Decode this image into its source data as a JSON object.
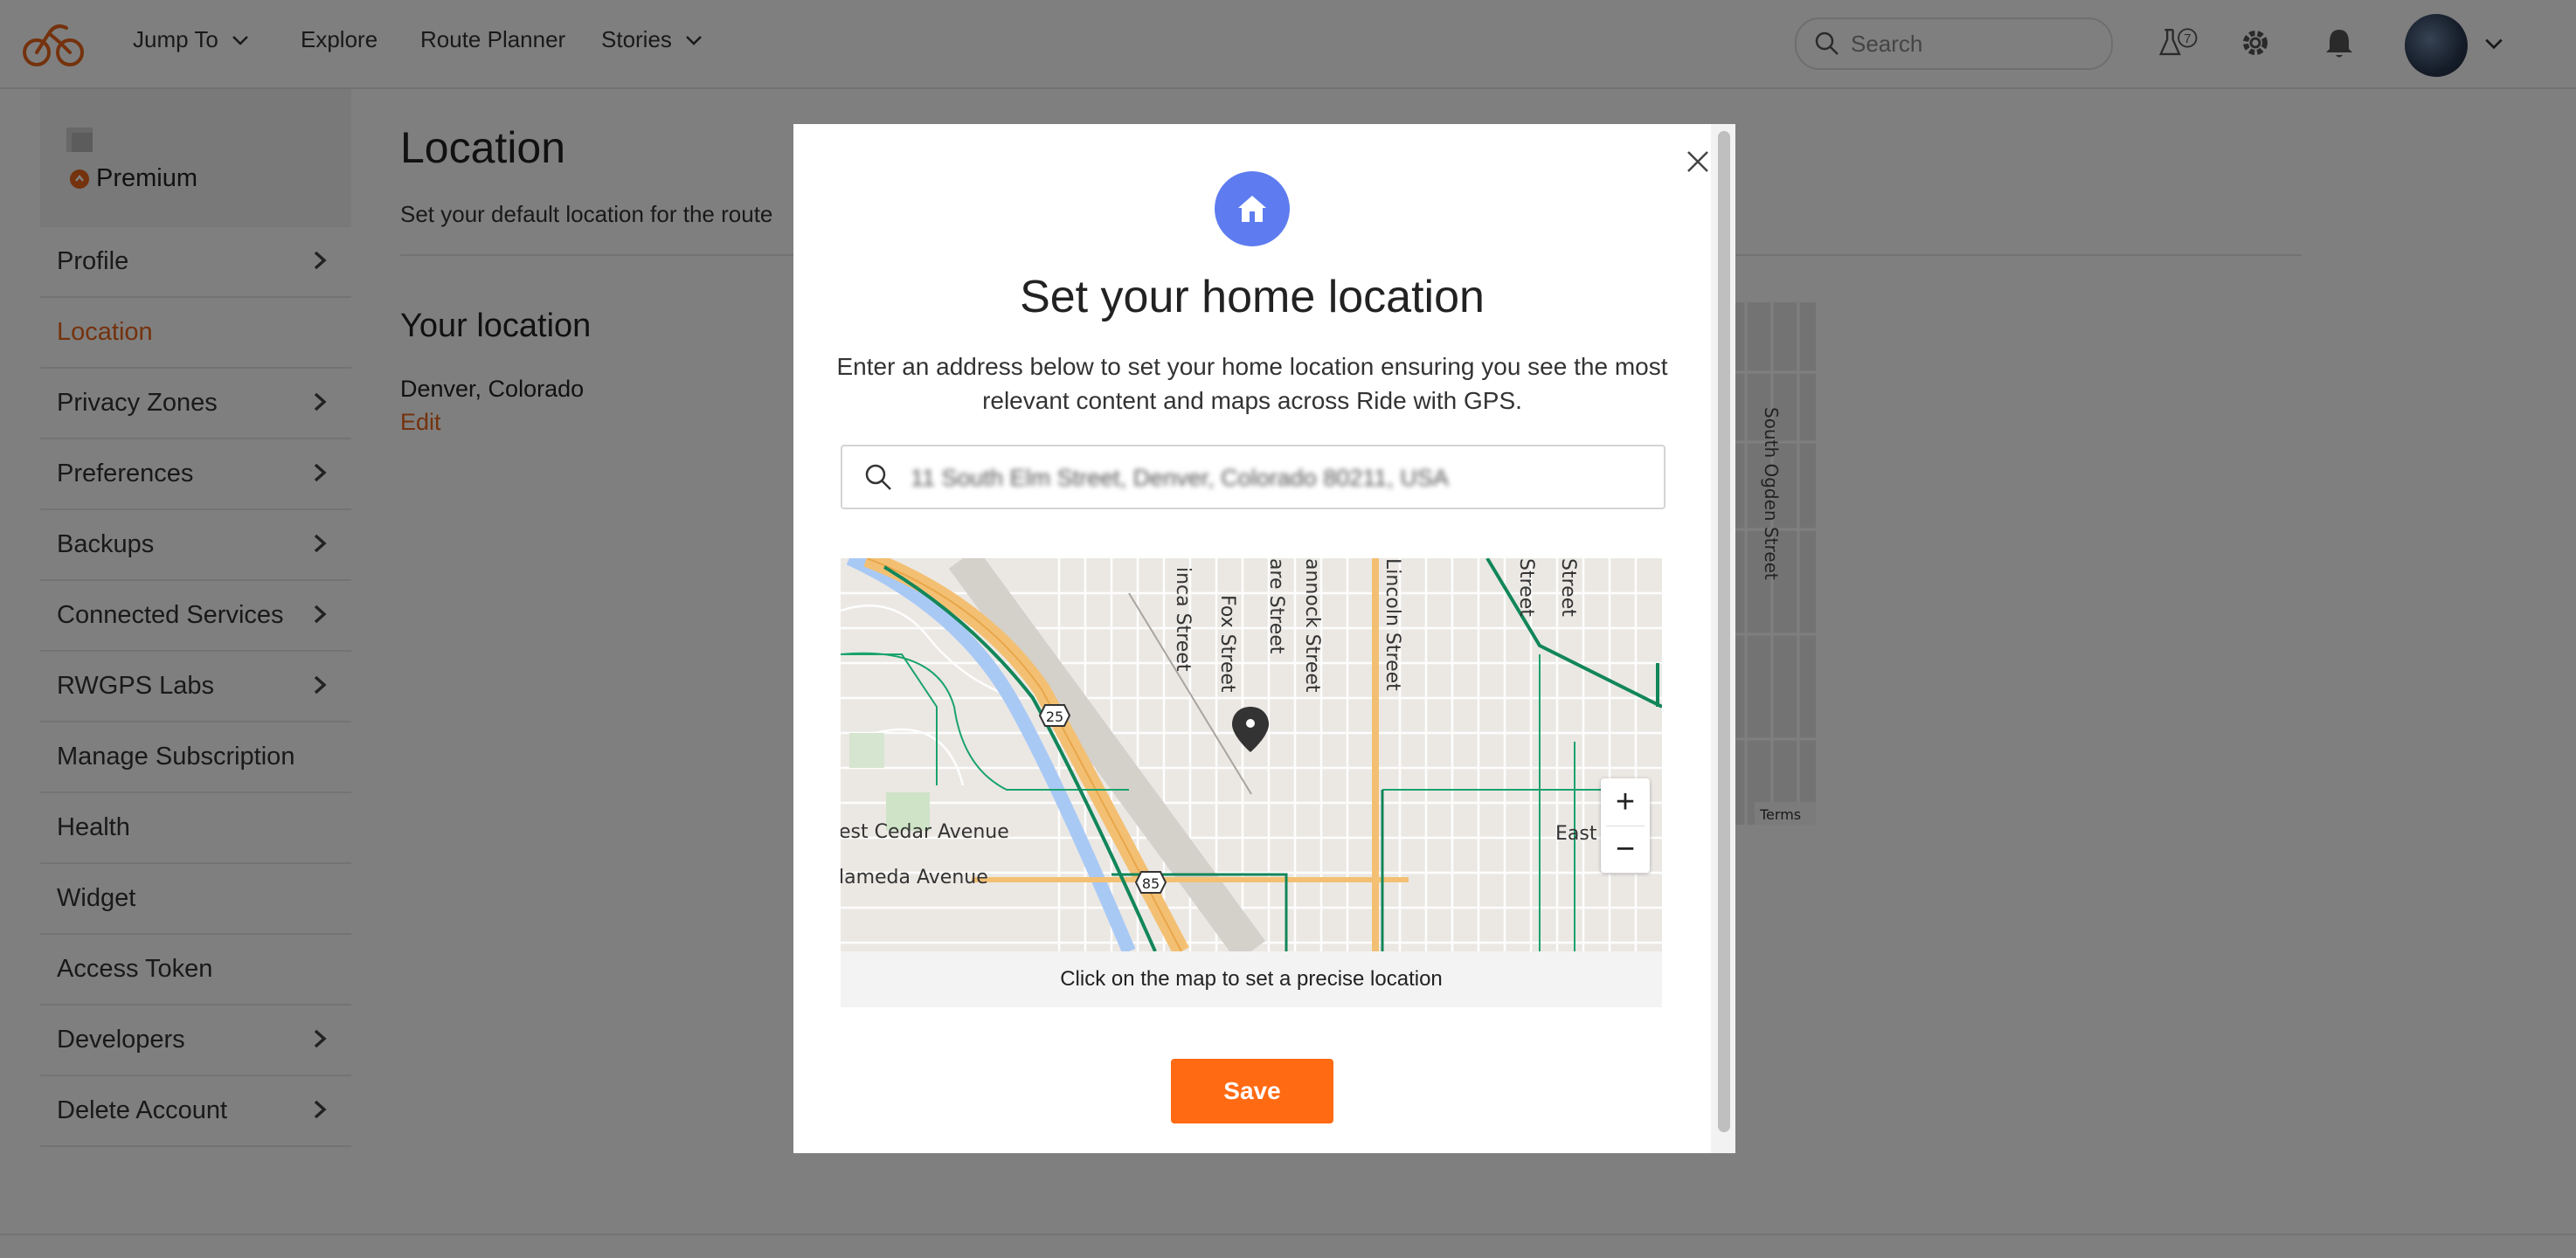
{
  "nav": {
    "jump_to": "Jump To",
    "explore": "Explore",
    "route_planner": "Route Planner",
    "stories": "Stories",
    "search_placeholder": "Search",
    "labs_badge": "7"
  },
  "sidebar": {
    "premium_label": "Premium",
    "items": [
      {
        "label": "Profile",
        "chevron": true
      },
      {
        "label": "Location",
        "active": true
      },
      {
        "label": "Privacy Zones",
        "chevron": true
      },
      {
        "label": "Preferences",
        "chevron": true
      },
      {
        "label": "Backups",
        "chevron": true
      },
      {
        "label": "Connected Services",
        "chevron": true
      },
      {
        "label": "RWGPS Labs",
        "chevron": true
      },
      {
        "label": "Manage Subscription"
      },
      {
        "label": "Health"
      },
      {
        "label": "Widget"
      },
      {
        "label": "Access Token"
      },
      {
        "label": "Developers",
        "chevron": true
      },
      {
        "label": "Delete Account",
        "chevron": true
      }
    ]
  },
  "main": {
    "title": "Location",
    "subtitle": "Set your default location for the route",
    "section_title": "Your location",
    "location_value": "Denver, Colorado",
    "edit_label": "Edit",
    "bg_map_street": "South Ogden Street",
    "bg_map_terms": "Terms"
  },
  "modal": {
    "title": "Set your home location",
    "description": "Enter an address below to set your home location ensuring you see the most relevant content and maps across Ride with GPS.",
    "address_value": "11 South Elm Street, Denver, Colorado 80211, USA",
    "map_caption": "Click on the map to set a precise location",
    "zoom_in": "+",
    "zoom_out": "−",
    "save_label": "Save",
    "map_labels": {
      "street_1": "inca Street",
      "street_2": "Fox Street",
      "street_3": "are Street",
      "street_4": "annock Street",
      "street_5": "Lincoln Street",
      "street_6": "Street",
      "street_7": "Street",
      "avenue_1": "est Cedar Avenue",
      "avenue_2": "lameda Avenue",
      "east_label": "East",
      "shield_25": "25",
      "shield_85": "85"
    }
  },
  "colors": {
    "accent": "#e8651a",
    "save_button": "#ff6a13",
    "home_icon_bg": "#5e7cf0"
  }
}
